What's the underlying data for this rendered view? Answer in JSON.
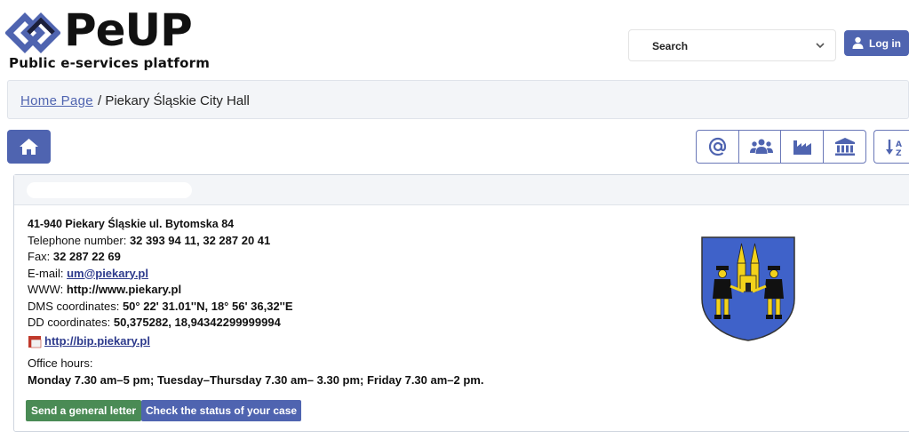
{
  "header": {
    "logo_title": "PeUP",
    "logo_subtitle": "Public e-services platform",
    "search_label": "Search",
    "login_label": "Log in"
  },
  "breadcrumb": {
    "home": "Home Page",
    "separator_current": "/ Piekary Śląskie City Hall"
  },
  "office": {
    "address": "41-940 Piekary Śląskie ul. Bytomska 84",
    "phone_label": "Telephone number:",
    "phone_value": "32 393 94 11, 32 287 20 41",
    "fax_label": "Fax:",
    "fax_value": "32 287 22 69",
    "email_label": "E-mail:",
    "email_value": "um@piekary.pl",
    "www_label": "WWW:",
    "www_value": "http://www.piekary.pl",
    "dms_label": "DMS coordinates:",
    "dms_value": "50° 22' 31.01''N, 18° 56' 36,32''E",
    "dd_label": "DD coordinates:",
    "dd_value": "50,375282, 18,94342299999994",
    "bip_link": "http://bip.piekary.pl",
    "hours_label": "Office hours:",
    "hours_value": "Monday 7.30 am–5 pm; Tuesday–Thursday 7.30 am– 3.30 pm; Friday 7.30 am–2 pm."
  },
  "actions": {
    "general_letter": "Send a general letter",
    "check_status": "Check the status of your case"
  },
  "icons": [
    "home-icon",
    "at-icon",
    "users-icon",
    "factory-icon",
    "institution-icon",
    "sort-icon",
    "search-chevron-icon",
    "user-icon",
    "bip-icon",
    "coat-of-arms"
  ],
  "colors": {
    "primary": "#4f64b0",
    "green": "#4a8b55",
    "crest_blue": "#3f62c9",
    "crest_gold": "#f2d21b"
  }
}
